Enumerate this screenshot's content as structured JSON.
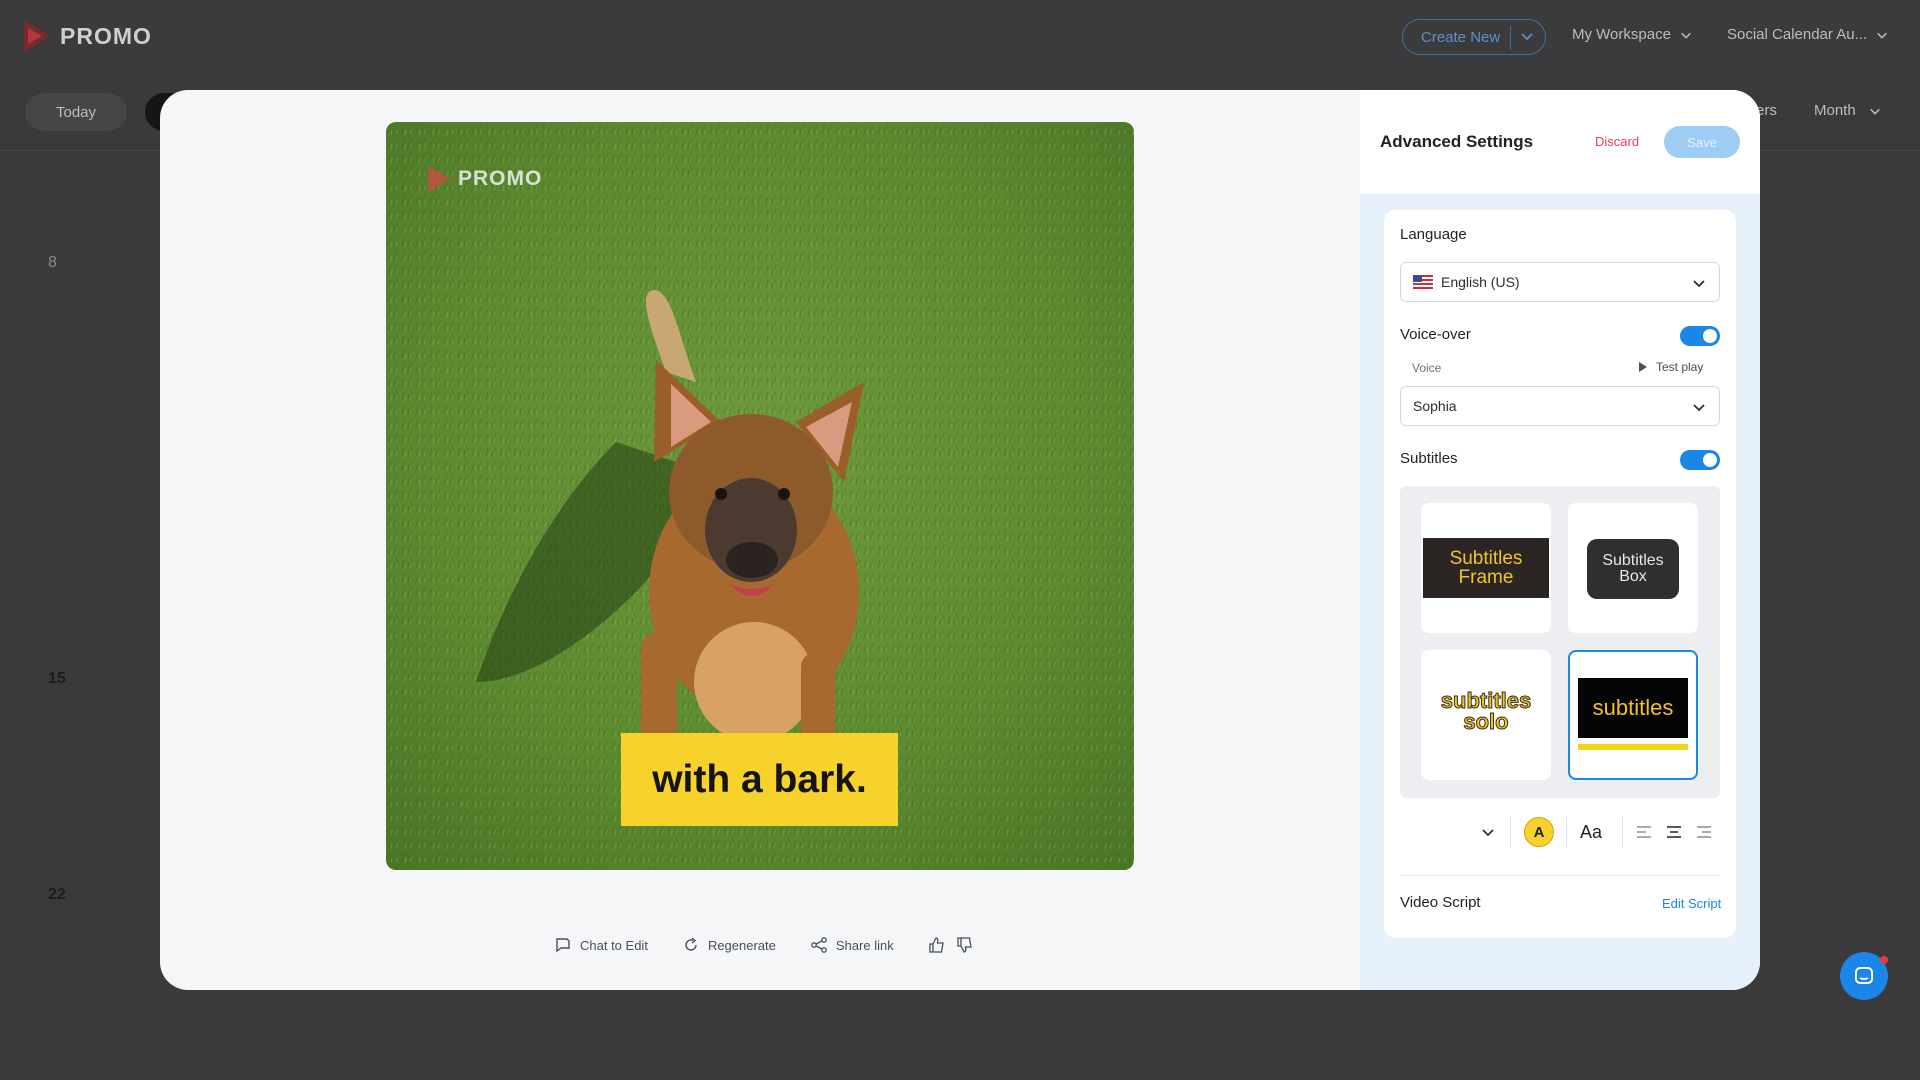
{
  "app": {
    "brand": "PROMO",
    "create_new": "Create New",
    "workspace": "My Workspace",
    "calendar_title": "Social Calendar Au...",
    "today": "Today",
    "filters_partial": "ers",
    "view": "Month",
    "days": [
      "8",
      "15",
      "22"
    ]
  },
  "video": {
    "watermark": "PROMO",
    "caption": "with a bark."
  },
  "actions": {
    "chat": "Chat to Edit",
    "regenerate": "Regenerate",
    "share": "Share link"
  },
  "panel": {
    "title": "Advanced Settings",
    "discard": "Discard",
    "save": "Save",
    "language_label": "Language",
    "language_value": "English (US)",
    "voiceover_label": "Voice-over",
    "voiceover_on": true,
    "voice_label": "Voice",
    "test_play": "Test play",
    "voice_value": "Sophia",
    "subtitles_label": "Subtitles",
    "subtitles_on": true,
    "styles": {
      "frame_line1": "Subtitles",
      "frame_line2": "Frame",
      "box_line1": "Subtitles",
      "box_line2": "Box",
      "solo_line1": "subtitles",
      "solo_line2": "solo",
      "selected": "subtitles"
    },
    "font_color_letter": "A",
    "font_style_glyph": "Aa",
    "video_script_label": "Video Script",
    "edit_script": "Edit Script"
  },
  "colors": {
    "accent": "#1a86e8",
    "caption_bg": "#f7d22a",
    "discard": "#e23d62"
  }
}
